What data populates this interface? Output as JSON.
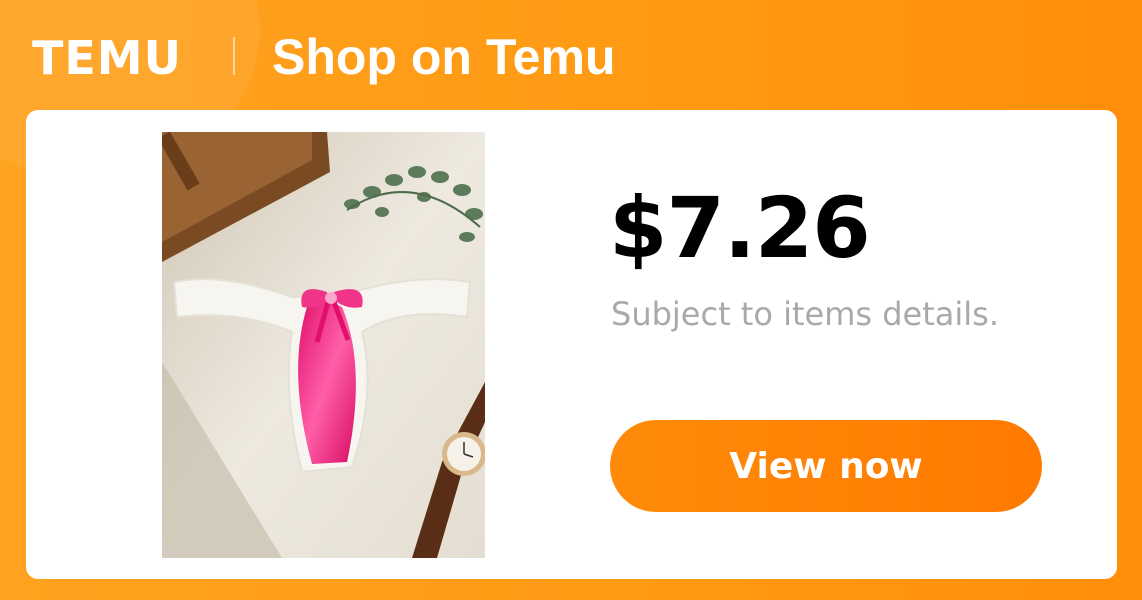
{
  "header": {
    "logo_text": "TEMU",
    "title": "Shop on Temu"
  },
  "product": {
    "image_icon": "product-photo",
    "price": "$7.26",
    "note": "Subject to items details."
  },
  "cta": {
    "label": "View now"
  },
  "colors": {
    "brand_orange": "#FF9A14",
    "button_orange": "#FF7F05",
    "subtext_gray": "#A9A9A9"
  }
}
